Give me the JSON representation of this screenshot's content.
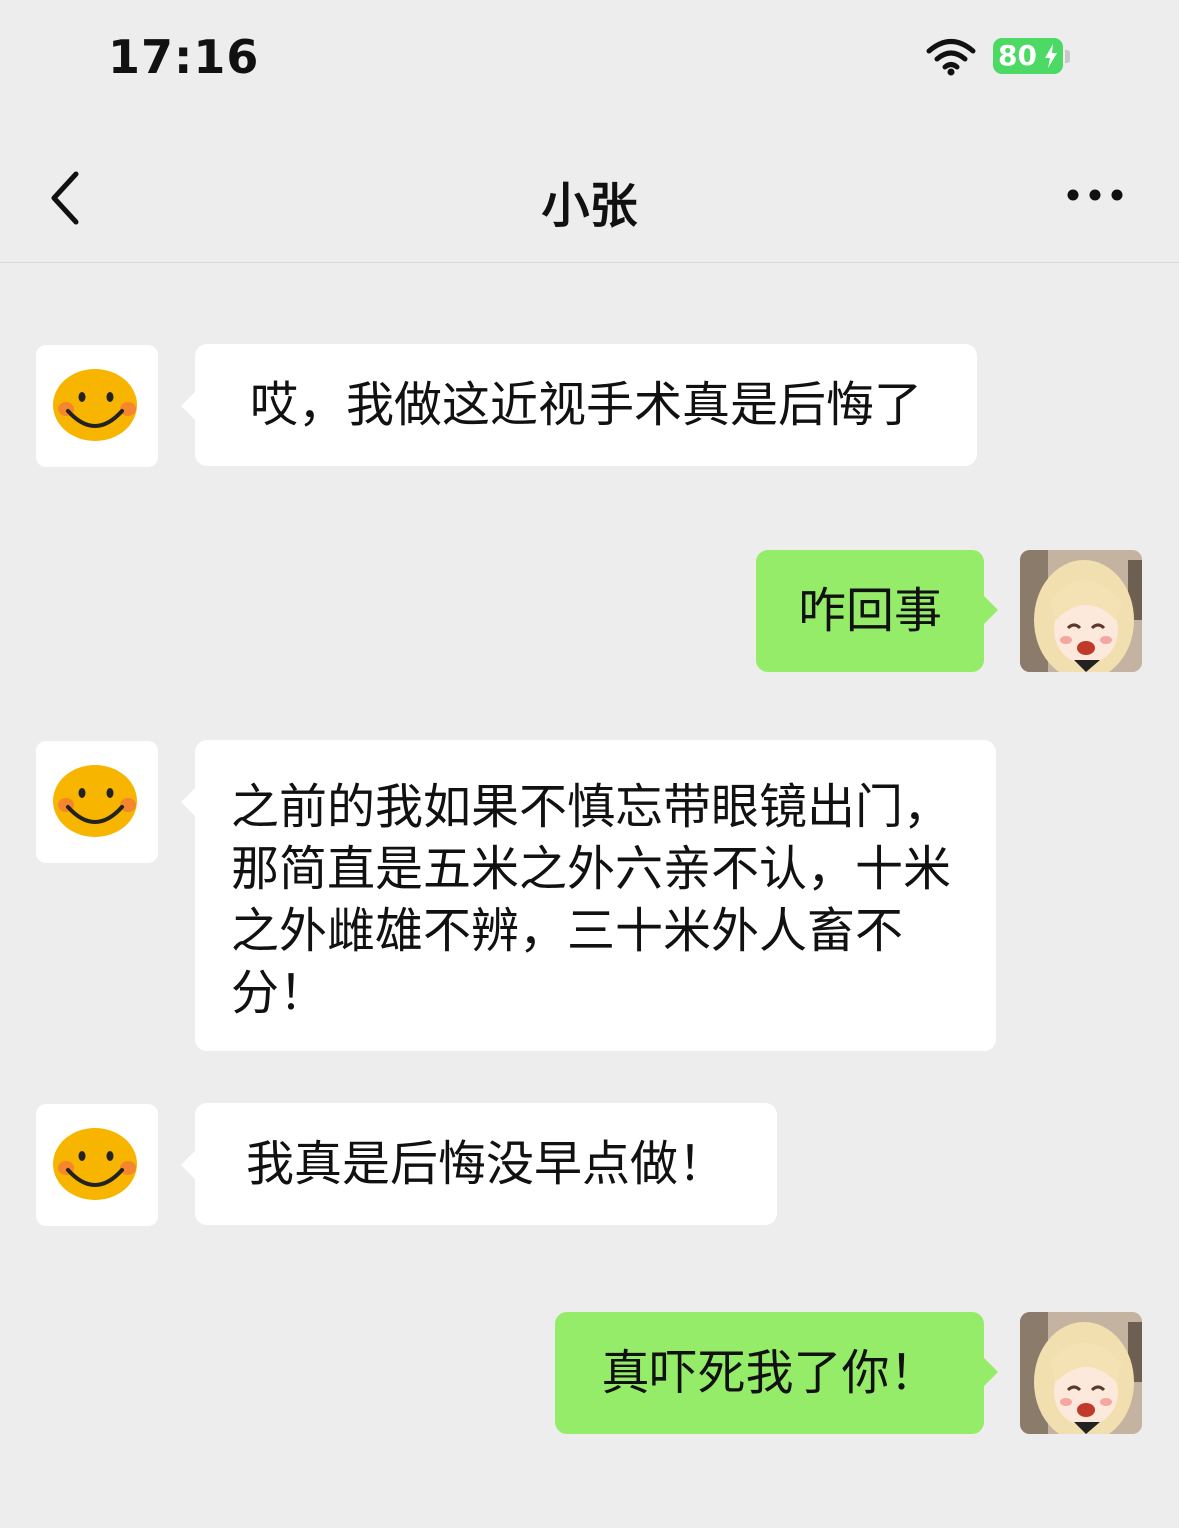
{
  "status_bar": {
    "time": "17:16",
    "battery_level": "80",
    "wifi_icon": "wifi-icon",
    "battery_color": "#4cd964"
  },
  "nav": {
    "title": "小张",
    "back_icon": "chevron-left-icon",
    "more_icon": "more-dots-icon"
  },
  "colors": {
    "background": "#ededed",
    "incoming_bubble": "#ffffff",
    "outgoing_bubble": "#95ec69"
  },
  "messages": [
    {
      "sender": "contact",
      "avatar": "smiley-avatar",
      "text": "哎，我做这近视手术真是后悔了"
    },
    {
      "sender": "me",
      "avatar": "anime-girl-avatar",
      "text": "咋回事"
    },
    {
      "sender": "contact",
      "avatar": "smiley-avatar",
      "text": "之前的我如果不慎忘带眼镜出门，那简直是五米之外六亲不认，十米之外雌雄不辨，三十米外人畜不分！"
    },
    {
      "sender": "contact",
      "avatar": "smiley-avatar",
      "text": "我真是后悔没早点做！"
    },
    {
      "sender": "me",
      "avatar": "anime-girl-avatar",
      "text": "真吓死我了你！"
    }
  ]
}
